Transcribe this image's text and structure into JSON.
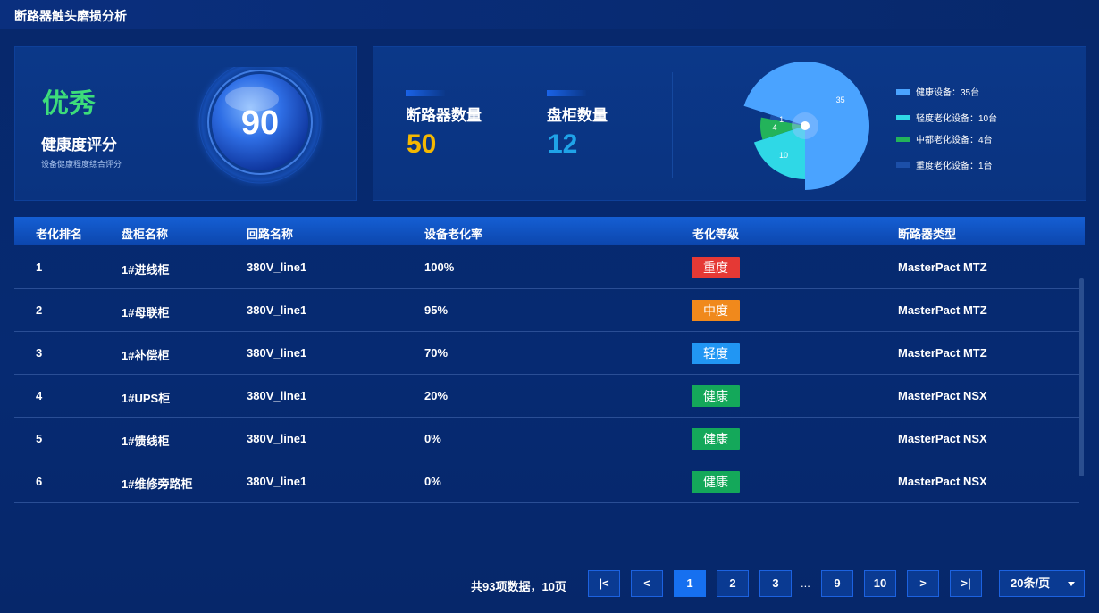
{
  "title": "断路器触头磨损分析",
  "health": {
    "grade": "优秀",
    "grade_color": "#3ddc7a",
    "title": "健康度评分",
    "subtitle": "设备健康程度综合评分",
    "score": "90"
  },
  "counts": {
    "breaker_label": "断路器数量",
    "breaker_value": "50",
    "breaker_color": "#f5b800",
    "cabinet_label": "盘柜数量",
    "cabinet_value": "12",
    "cabinet_color": "#1fa3e8"
  },
  "chart_data": {
    "type": "pie",
    "slices": [
      {
        "label": "健康设备：35台",
        "value": 35,
        "color": "#4aa3ff"
      },
      {
        "label": "轻度老化设备：10台",
        "value": 10,
        "color": "#2fd8e6"
      },
      {
        "label": "中都老化设备：4台",
        "value": 4,
        "color": "#23b35a"
      },
      {
        "label": "重度老化设备：1台",
        "value": 1,
        "color": "#1c4fa8"
      }
    ],
    "data_labels": [
      "35",
      "10",
      "4",
      "1"
    ]
  },
  "table": {
    "headers": [
      "老化排名",
      "盘柜名称",
      "回路名称",
      "设备老化率",
      "老化等级",
      "断路器类型"
    ],
    "rows": [
      {
        "rank": "1",
        "cabinet": "1#进线柜",
        "circuit": "380V_line1",
        "rate": "100%",
        "level": "重度",
        "level_color": "#e53935",
        "type": "MasterPact MTZ"
      },
      {
        "rank": "2",
        "cabinet": "1#母联柜",
        "circuit": "380V_line1",
        "rate": "95%",
        "level": "中度",
        "level_color": "#f0891c",
        "type": "MasterPact MTZ"
      },
      {
        "rank": "3",
        "cabinet": "1#补偿柜",
        "circuit": "380V_line1",
        "rate": "70%",
        "level": "轻度",
        "level_color": "#2196f3",
        "type": "MasterPact MTZ"
      },
      {
        "rank": "4",
        "cabinet": "1#UPS柜",
        "circuit": "380V_line1",
        "rate": "20%",
        "level": "健康",
        "level_color": "#14a85a",
        "type": "MasterPact NSX"
      },
      {
        "rank": "5",
        "cabinet": "1#馈线柜",
        "circuit": "380V_line1",
        "rate": "0%",
        "level": "健康",
        "level_color": "#14a85a",
        "type": "MasterPact NSX"
      },
      {
        "rank": "6",
        "cabinet": "1#维修旁路柜",
        "circuit": "380V_line1",
        "rate": "0%",
        "level": "健康",
        "level_color": "#14a85a",
        "type": "MasterPact NSX"
      }
    ]
  },
  "pagination": {
    "info": "共93项数据，10页",
    "first": "|<",
    "prev": "<",
    "pages": [
      "1",
      "2",
      "3",
      "9",
      "10"
    ],
    "current": "1",
    "ellipsis": "...",
    "next": ">",
    "last": ">|",
    "page_size": "20条/页"
  }
}
